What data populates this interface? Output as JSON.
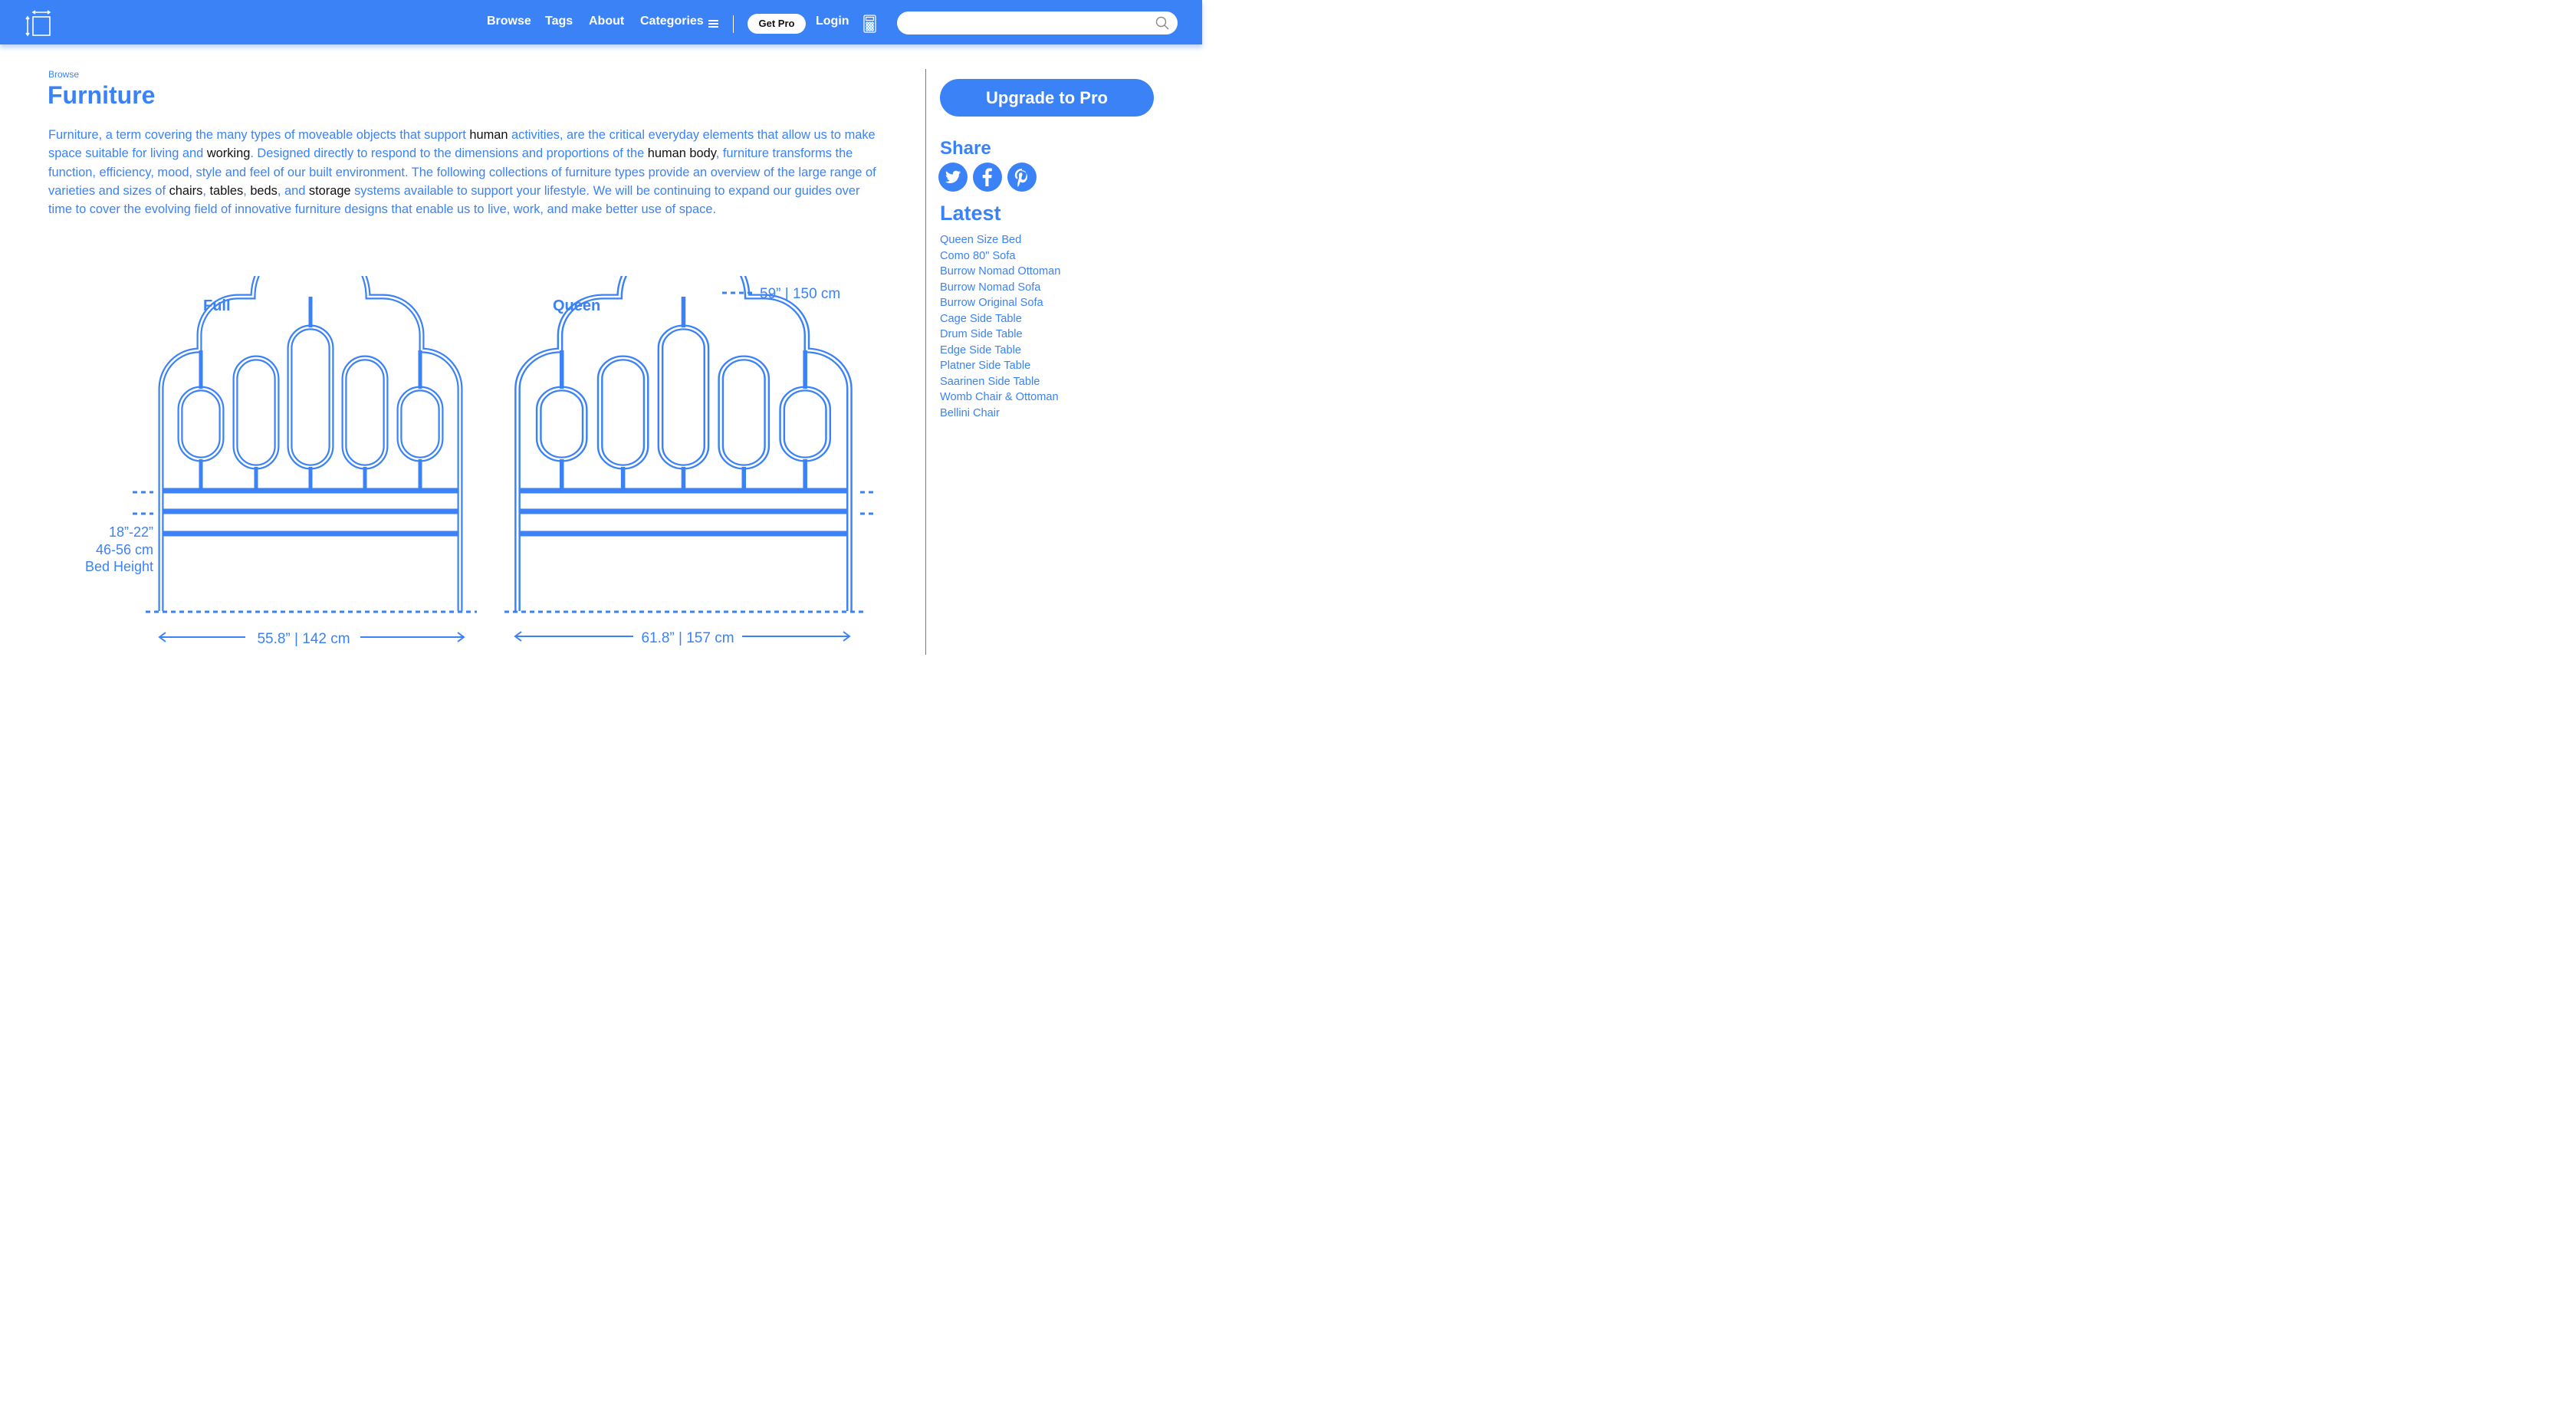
{
  "navbar": {
    "links": [
      "Browse",
      "Tags",
      "About",
      "Categories"
    ],
    "get_pro_label": "Get Pro",
    "login_label": "Login",
    "search_placeholder": ""
  },
  "breadcrumb": "Browse",
  "page_title": "Furniture",
  "intro": {
    "p1": "Furniture, a term covering the many types of moveable objects that support ",
    "link_human": "human",
    "p2": " activities, are the critical everyday elements that allow us to make space suitable for living and ",
    "link_working": "working",
    "p3": ". Designed directly to respond to the dimensions and proportions of the ",
    "link_human_body": "human body",
    "p4": ", furniture transforms the function, efficiency, mood, style and feel of our built environment. The following collections of furniture types provide an overview of the large range of varieties and sizes of ",
    "link_chairs": "chairs",
    "sep1": ", ",
    "link_tables": "tables",
    "sep2": ", ",
    "link_beds": "beds",
    "sep3": ", and ",
    "link_storage": "storage",
    "p5": " systems available to support your lifestyle. We will be continuing to expand our guides over time to cover the evolving field of innovative furniture designs that enable us to live, work, and make better use of space."
  },
  "sidebar": {
    "upgrade_label": "Upgrade to Pro",
    "share_heading": "Share",
    "social_icons": [
      "twitter-icon",
      "facebook-icon",
      "pinterest-icon"
    ],
    "latest_heading": "Latest",
    "latest_items": [
      "Queen Size Bed",
      "Como 80\" Sofa",
      "Burrow Nomad Ottoman",
      "Burrow Nomad Sofa",
      "Burrow Original Sofa",
      "Cage Side Table",
      "Drum Side Table",
      "Edge Side Table",
      "Platner Side Table",
      "Saarinen Side Table",
      "Womb Chair & Ottoman",
      "Bellini Chair"
    ]
  },
  "diagram": {
    "full_label": "Full",
    "queen_label": "Queen",
    "height_dim": "59” | 150 cm",
    "bed_height_line1": "18”-22”",
    "bed_height_line2": "46-56 cm",
    "bed_height_line3": "Bed Height",
    "full_width": "55.8” | 142 cm",
    "queen_width": "61.8” | 157 cm"
  },
  "colors": {
    "brand": "#3b82f6",
    "link_text": "#111111",
    "background": "#ffffff"
  }
}
